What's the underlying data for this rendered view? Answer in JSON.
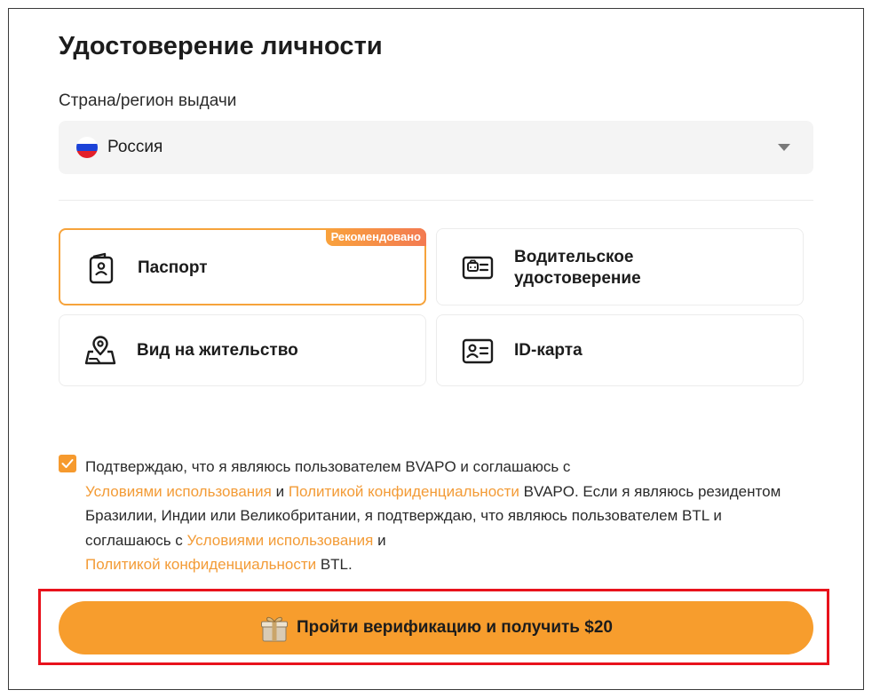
{
  "page": {
    "title": "Удостоверение личности"
  },
  "country": {
    "label": "Страна/регион выдачи",
    "selected": "Россия",
    "flag_icon": "russia-flag-icon"
  },
  "documents": [
    {
      "label": "Паспорт",
      "icon": "passport-icon",
      "selected": true,
      "badge": "Рекомендовано"
    },
    {
      "label_line1": "Водительское",
      "label_line2": "удостоверение",
      "icon": "driver-license-icon",
      "selected": false
    },
    {
      "label": "Вид на жительство",
      "icon": "residence-permit-icon",
      "selected": false
    },
    {
      "label": "ID-карта",
      "icon": "id-card-icon",
      "selected": false
    }
  ],
  "consent": {
    "checked": true,
    "t1": "Подтверждаю, что я являюсь пользователем BVAPO и соглашаюсь с ",
    "link_terms_1": "Условиями использования",
    "t2": " и ",
    "link_privacy_1": "Политикой конфиденциальности",
    "t3": " BVAPO. Если я являюсь резидентом Бразилии, Индии или Великобритании, я подтверждаю, что являюсь пользователем BTL и соглашаюсь с ",
    "link_terms_2": "Условиями использования",
    "t4": " и ",
    "link_privacy_2": "Политикой конфиденциальности",
    "t5": " BTL."
  },
  "cta": {
    "label": "Пройти верификацию и получить $20",
    "icon": "gift-icon"
  },
  "colors": {
    "accent": "#f79d2d",
    "link": "#f39b36",
    "highlight_box": "#e8121c",
    "selected_border": "#f6a33b"
  }
}
